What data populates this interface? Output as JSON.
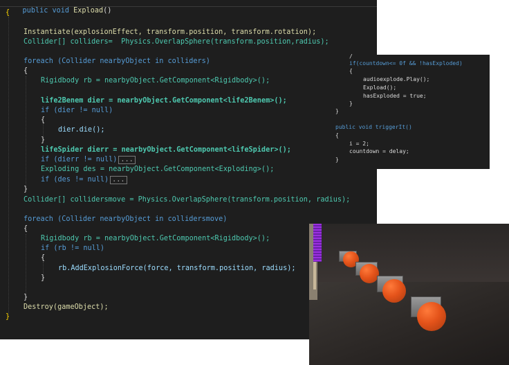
{
  "main_code": {
    "header": "public void Expload()",
    "lines": [
      "{",
      "Instantiate(explosionEffect, transform.position, transform.rotation);",
      "Collider[] colliders=  Physics.OverlapSphere(transform.position,radius);",
      "foreach (Collider nearbyObject in colliders)",
      "{",
      "Rigidbody rb = nearbyObject.GetComponent<Rigidbody>();",
      "life2Benem dier = nearbyObject.GetComponent<life2Benem>();",
      "if (dier != null)",
      "{",
      "dier.die();",
      "}",
      "lifeSpider dierr = nearbyObject.GetComponent<lifeSpider>();",
      "if (dierr != null)",
      "Exploding des = nearbyObject.GetComponent<Exploding>();",
      "if (des != null)",
      "}",
      "Collider[] collidersmove = Physics.OverlapSphere(transform.position, radius);",
      "foreach (Collider nearbyObject in collidersmove)",
      "{",
      "Rigidbody rb = nearbyObject.GetComponent<Rigidbody>();",
      "if (rb != null)",
      "{",
      "rb.AddExplosionForce(force, transform.position, radius);",
      "}",
      "}",
      "Destroy(gameObject);",
      "}"
    ],
    "fold_marker": "..."
  },
  "side_code": {
    "lines": [
      "/",
      "if(countdown<= 0f && !hasExploded)",
      "{",
      "audioexplode.Play();",
      "Expload();",
      "hasExploded = true;",
      "}",
      "}",
      "public void triggerIt()",
      "{",
      "i = 2;",
      "countdown = delay;",
      "}"
    ]
  },
  "scene": {
    "sphere_color": "#e4531a",
    "wall_accent": "#9b30e0"
  }
}
